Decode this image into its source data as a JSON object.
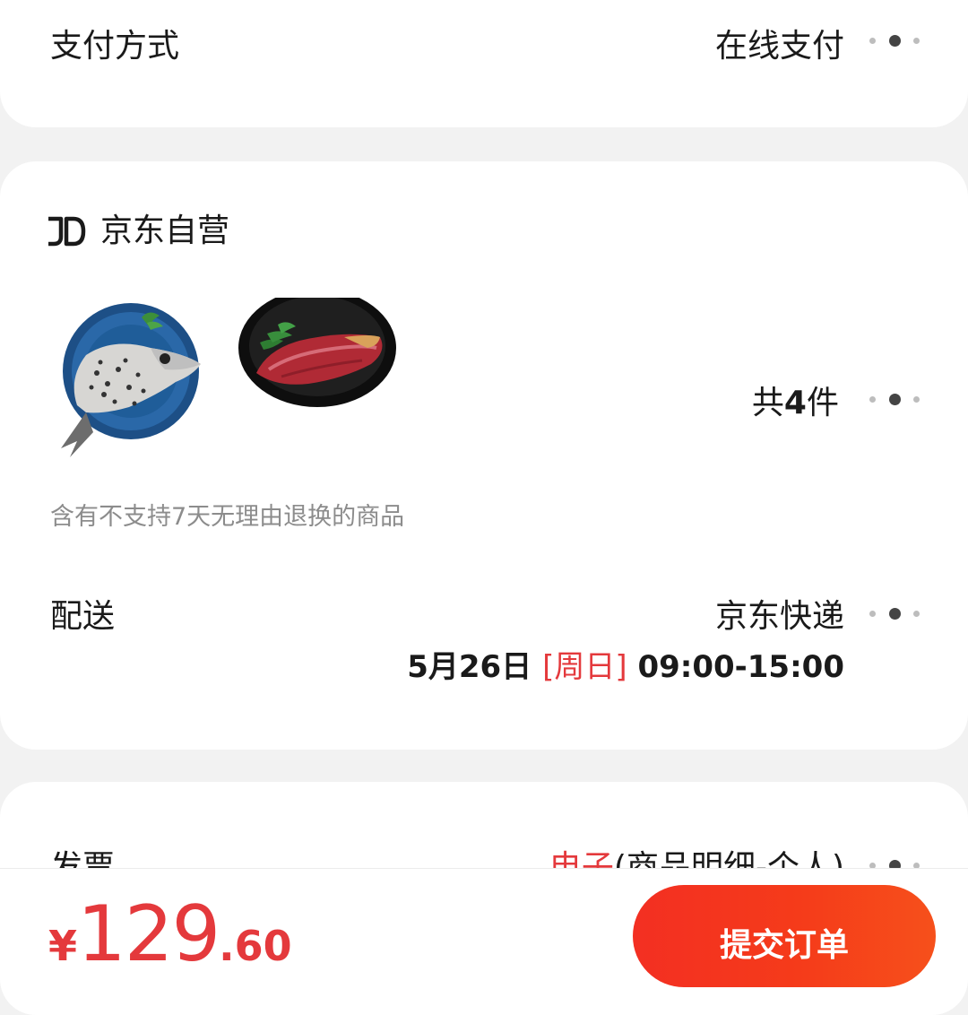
{
  "payment": {
    "label": "支付方式",
    "value": "在线支付",
    "more_icon": "more-dots-icon"
  },
  "shop": {
    "logo_icon": "jd-logo-icon",
    "name": "京东自营"
  },
  "products": [
    {
      "name": "salmon-head",
      "image_icon": "fish-head-image"
    },
    {
      "name": "beef",
      "image_icon": "beef-image"
    }
  ],
  "items_count": {
    "prefix": "共",
    "number": "4",
    "suffix": "件"
  },
  "return_note": "含有不支持7天无理由退换的商品",
  "delivery": {
    "label": "配送",
    "value": "京东快递",
    "date": "5月26日",
    "weekday": "[周日]",
    "time": "09:00-15:00"
  },
  "invoice": {
    "label": "发票",
    "type": "电子",
    "detail": "(商品明细-个人)"
  },
  "total": {
    "currency": "¥",
    "integer": "129",
    "decimal": ".60"
  },
  "submit_label": "提交订单",
  "colors": {
    "accent": "#e4393c",
    "button": "#f32f22",
    "background": "#f2f2f2"
  }
}
